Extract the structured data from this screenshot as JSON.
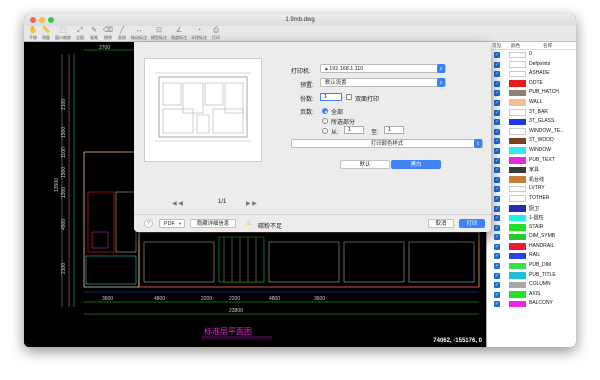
{
  "window": {
    "title": "1.9mb.dwg"
  },
  "toolbar": {
    "items": [
      "平移",
      "测量",
      "窗口缩放",
      "全图",
      "画笔",
      "擦除",
      "直线",
      "拖动标注",
      "模型标注",
      "角度标注",
      "半径标注",
      "打印"
    ]
  },
  "drawing": {
    "dims_top": [
      "2700",
      "3600",
      "4800",
      "2200",
      "2200",
      "4800",
      "3600"
    ],
    "dim_total": "23800",
    "dims_left": [
      "2100",
      "1500",
      "1100",
      "1500",
      "1300",
      "4500",
      "2100"
    ],
    "dim_left_total": "13500",
    "plan_title": "标准层平面图",
    "coords": "74062, -155176, 0"
  },
  "layers": {
    "headers": {
      "visible": "可见",
      "color": "颜色",
      "name": "名称"
    },
    "items": [
      {
        "name": "0",
        "color": "#ffffff"
      },
      {
        "name": "Defpoints",
        "color": "#ffffff"
      },
      {
        "name": "ASHADE",
        "color": "#ffffff"
      },
      {
        "name": "DOTE",
        "color": "#e8191d"
      },
      {
        "name": "PUB_HATCH",
        "color": "#8c8173"
      },
      {
        "name": "WALL",
        "color": "#f2bf94"
      },
      {
        "name": "3T_BAR",
        "color": "#ffffff"
      },
      {
        "name": "3T_GLASS",
        "color": "#1d35f0"
      },
      {
        "name": "WINDOW_TE...",
        "color": "#ffffff"
      },
      {
        "name": "3T_WOOD",
        "color": "#7b3f24"
      },
      {
        "name": "WINDOW",
        "color": "#33e8f0"
      },
      {
        "name": "PUB_TEXT",
        "color": "#e52ad8"
      },
      {
        "name": "家具",
        "color": "#3a3a3a"
      },
      {
        "name": "机台线",
        "color": "#c57f3a"
      },
      {
        "name": "LVTRY",
        "color": "#ffffff"
      },
      {
        "name": "TOTHER",
        "color": "#ffffff"
      },
      {
        "name": "厨卫",
        "color": "#2a2ab0"
      },
      {
        "name": "1-圆柱",
        "color": "#1df0e8"
      },
      {
        "name": "STAIR",
        "color": "#21e02c"
      },
      {
        "name": "DIM_SYMB",
        "color": "#26c82b"
      },
      {
        "name": "HANDRAIL",
        "color": "#ec1a2e"
      },
      {
        "name": "RAIL",
        "color": "#2743e5"
      },
      {
        "name": "PUB_DIM",
        "color": "#35e04a"
      },
      {
        "name": "PUB_TITLE",
        "color": "#21c0d8"
      },
      {
        "name": "COLUMN",
        "color": "#a8a8a8"
      },
      {
        "name": "AXIS",
        "color": "#22e32a"
      },
      {
        "name": "BALCONY",
        "color": "#ee23e6"
      }
    ]
  },
  "print_dialog": {
    "printer_label": "打印机:",
    "printer_value": "192.168.1.110",
    "preset_label": "预置:",
    "preset_value": "默认设置",
    "copies_label": "份数:",
    "copies_value": "1",
    "duplex_label": "双面打印",
    "pages_label": "页数:",
    "all_label": "全部",
    "selection_label": "所选部分",
    "from_label": "从:",
    "from_value": "1",
    "to_label": "至:",
    "to_value": "1",
    "style_value": "打印颜色样式",
    "default_btn": "默认",
    "bw_btn": "黑白",
    "page_indicator": "1/1",
    "help": "?",
    "pdf_label": "PDF",
    "hide_details": "隐藏详细信息",
    "warning_text": "碳粉不足",
    "cancel": "取消",
    "print": "打印"
  }
}
